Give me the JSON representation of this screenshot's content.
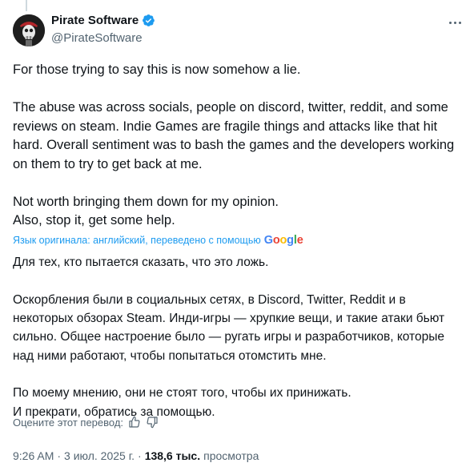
{
  "author": {
    "name": "Pirate Software",
    "handle": "@PirateSoftware",
    "verified": true
  },
  "tweet": {
    "paragraphs": [
      "For those trying to say this is now somehow a lie.",
      "The abuse was across socials, people on discord, twitter, reddit, and some reviews on steam. Indie Games are fragile things and attacks like that hit hard. Overall sentiment was to bash the games and the developers working on them to try to get back at me.",
      "Not worth bringing them down for my opinion.\nAlso, stop it, get some help."
    ]
  },
  "translation": {
    "note": "Язык оригинала: английский, переведено с помощью",
    "provider": "Google",
    "paragraphs": [
      "Для тех, кто пытается сказать, что это ложь.",
      "Оскорбления были в социальных сетях, в Discord, Twitter, Reddit и в некоторых обзорах Steam. Инди-игры — хрупкие вещи, и такие атаки бьют сильно. Общее настроение было — ругать игры и разработчиков, которые над ними работают, чтобы попытаться отомстить мне.",
      "По моему мнению, они не стоят того, чтобы их принижать.\nИ прекрати, обратись за помощью."
    ]
  },
  "rate": {
    "label": "Оцените этот перевод:"
  },
  "meta": {
    "time": "9:26 AM",
    "date": "3 июл. 2025 г.",
    "views_count": "138,6 тыс.",
    "views_label": "просмотра"
  },
  "icons": {
    "verified": "verified-badge-icon",
    "more": "more-options-icon",
    "thumb_up": "thumbs-up-icon",
    "thumb_down": "thumbs-down-icon"
  },
  "colors": {
    "accent": "#1d9bf0",
    "text": "#0f1419",
    "muted": "#536471"
  }
}
